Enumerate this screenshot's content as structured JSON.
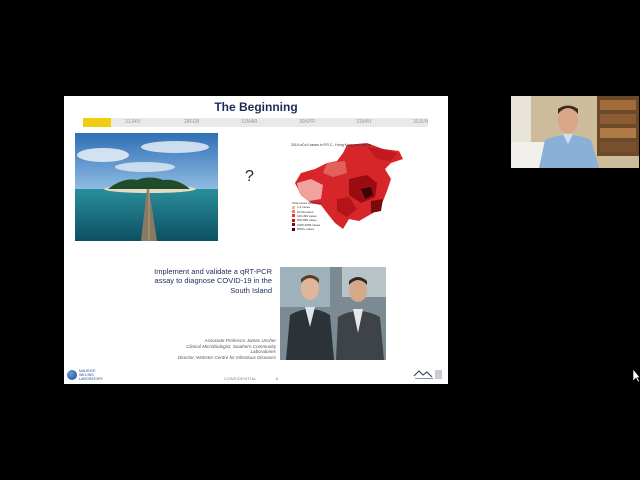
{
  "slide": {
    "title": "The Beginning",
    "timeline": {
      "labels": [
        "31JAN",
        "28FEB",
        "31MAR",
        "30APR",
        "31MAY",
        "30JUN"
      ],
      "progress_fraction": 0.08,
      "accent_color": "#f1cd12"
    },
    "question_mark": "?",
    "map": {
      "title": "2019-nCoV cases in P.R.C., Hong Kong and Macau",
      "legend_title": "Total cases confirmed",
      "legend_items": [
        {
          "label": "1-9 cases",
          "color": "#f4b5b0"
        },
        {
          "label": "10-99 cases",
          "color": "#ea7d78"
        },
        {
          "label": "100-499 cases",
          "color": "#db3b35"
        },
        {
          "label": "500-999 cases",
          "color": "#b3141a"
        },
        {
          "label": "1000-4999 cases",
          "color": "#7a0a0e"
        },
        {
          "label": "5000+ cases",
          "color": "#3b0507"
        }
      ]
    },
    "statement": "Implement and validate a qRT-PCR assay to diagnose COVID-19 in the South Island",
    "caption": {
      "line1": "Associate Professor James Ussher",
      "line2": "Clinical Microbiologist, Southern Community Laboratories",
      "line3": "Director, Webster Centre for Infectious Diseases"
    },
    "footer": {
      "logo_text": "MAURICE WILKINS LABORATORY",
      "confidential": "CONFIDENTIAL",
      "page_number": "6"
    }
  },
  "webcam": {
    "label": "presenter-video"
  }
}
